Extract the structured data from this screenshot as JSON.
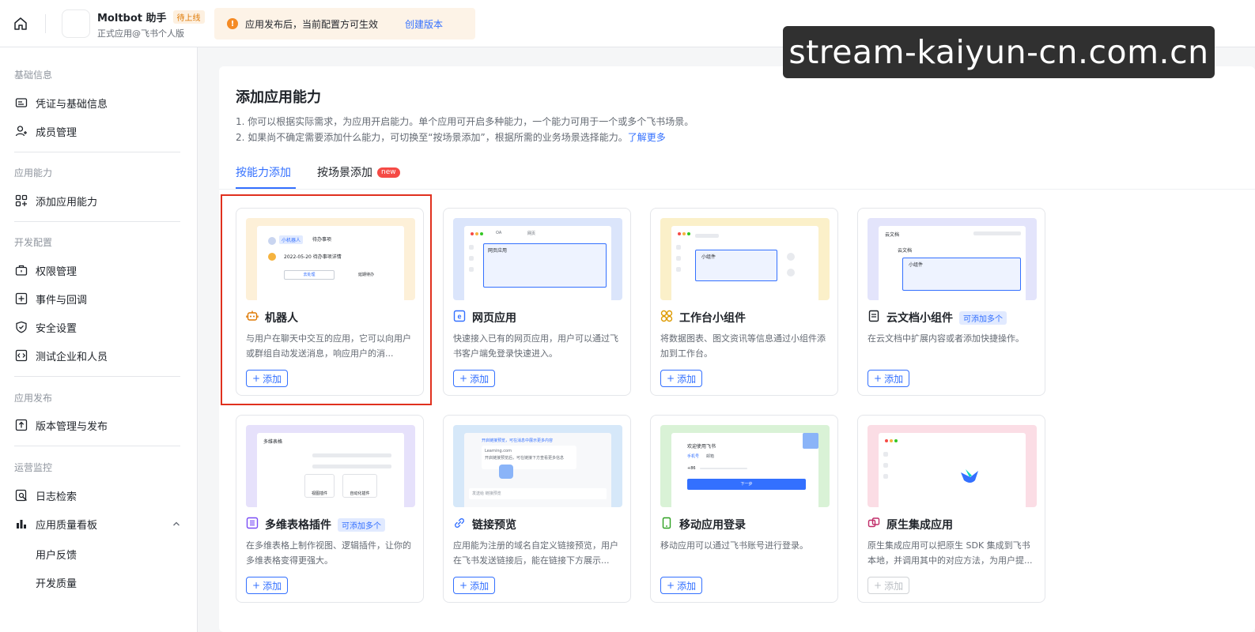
{
  "topbar": {
    "app_name": "Moltbot 助手",
    "status_badge": "待上线",
    "app_subtitle": "正式应用@飞书个人版",
    "notice_text": "应用发布后，当前配置方可生效",
    "notice_link": "创建版本"
  },
  "watermark": "stream-kaiyun-cn.com.cn",
  "sidebar": {
    "sections": [
      {
        "title": "基础信息",
        "items": [
          "凭证与基础信息",
          "成员管理"
        ]
      },
      {
        "title": "应用能力",
        "items": [
          "添加应用能力"
        ]
      },
      {
        "title": "开发配置",
        "items": [
          "权限管理",
          "事件与回调",
          "安全设置",
          "测试企业和人员"
        ]
      },
      {
        "title": "应用发布",
        "items": [
          "版本管理与发布"
        ]
      },
      {
        "title": "运营监控",
        "items": [
          "日志检索",
          "应用质量看板"
        ]
      }
    ],
    "sub_items": [
      "用户反馈",
      "开发质量"
    ]
  },
  "main": {
    "title": "添加应用能力",
    "desc1": "1. 你可以根据实际需求，为应用开启能力。单个应用可开启多种能力，一个能力可用于一个或多个飞书场景。",
    "desc2": "2. 如果尚不确定需要添加什么能力，可切换至“按场景添加”，根据所需的业务场景选择能力。",
    "desc2_link": "了解更多",
    "tabs": [
      "按能力添加",
      "按场景添加"
    ],
    "new_badge": "new"
  },
  "cards": [
    {
      "title": "机器人",
      "desc": "与用户在聊天中交互的应用，它可以向用户或群组自动发送消息，响应用户的消...",
      "button": "添加",
      "tag": "",
      "preview": {
        "chip": "小机器人",
        "chip_text": "待办事项",
        "line": "2022-05-20 待办事项详情",
        "btn1": "去处理",
        "btn2": "延期待办"
      }
    },
    {
      "title": "网页应用",
      "desc": "快速接入已有的网页应用，用户可以通过飞书客户端免登录快速进入。",
      "button": "添加",
      "tag": "",
      "preview": {
        "tab1": "OA",
        "tab2": "网页",
        "box": "网页应用"
      }
    },
    {
      "title": "工作台小组件",
      "desc": "将数据图表、图文资讯等信息通过小组件添加到工作台。",
      "button": "添加",
      "tag": "",
      "preview": {
        "box": "小组件"
      }
    },
    {
      "title": "云文档小组件",
      "desc": "在云文档中扩展内容或者添加快捷操作。",
      "button": "添加",
      "tag": "可添加多个",
      "preview": {
        "head": "云文档",
        "sub": "云文档",
        "box": "小组件"
      }
    },
    {
      "title": "多维表格插件",
      "desc": "在多维表格上制作视图、逻辑插件，让你的多维表格变得更强大。",
      "button": "添加",
      "tag": "可添加多个",
      "preview": {
        "head": "多维表格",
        "a": "视图插件",
        "b": "自动化插件"
      }
    },
    {
      "title": "链接预览",
      "desc": "应用能为注册的域名自定义链接预览，用户在飞书发送链接后，能在链接下方展示...",
      "button": "添加",
      "tag": "",
      "preview": {
        "msg": "开启链接预览，可在消息中展示更多内容",
        "link": "Learning.com",
        "msg2": "开启链接预览后，可在链接下方查看更多信息",
        "input": "发送给 链接预览"
      }
    },
    {
      "title": "移动应用登录",
      "desc": "移动应用可以通过飞书账号进行登录。",
      "button": "添加",
      "tag": "",
      "preview": {
        "welcome": "欢迎使用飞书",
        "t1": "手机号",
        "t2": "邮箱",
        "code": "+86",
        "next": "下一步"
      }
    },
    {
      "title": "原生集成应用",
      "desc": "原生集成应用可以把原生 SDK 集成到飞书本地，并调用其中的对应方法，为用户提...",
      "button": "添加",
      "tag": "",
      "preview": {}
    }
  ],
  "colors": {
    "accent": "#3370ff",
    "highlight": "#e0301e",
    "warning": "#f58b25"
  }
}
